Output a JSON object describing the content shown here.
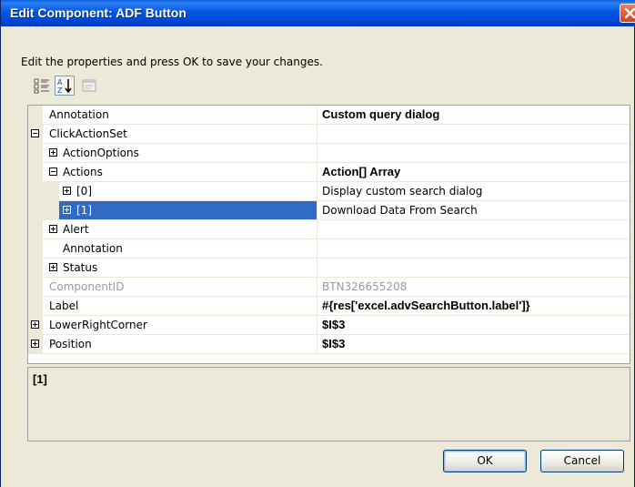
{
  "window": {
    "title": "Edit Component: ADF Button",
    "instructions": "Edit the properties and press OK to save your changes."
  },
  "toolbar": {
    "buttons": [
      {
        "icon": "categorized-icon"
      },
      {
        "icon": "alphabetical-sort-icon"
      },
      {
        "icon": "property-pages-icon"
      }
    ]
  },
  "properties": [
    {
      "name": "Annotation",
      "value": "Custom query dialog"
    },
    {
      "name": "ClickActionSet",
      "value": ""
    },
    {
      "name": "ActionOptions",
      "value": ""
    },
    {
      "name": "Actions",
      "value": "Action[] Array"
    },
    {
      "name": "[0]",
      "value": "Display custom search dialog"
    },
    {
      "name": "[1]",
      "value": "Download Data From Search"
    },
    {
      "name": "Alert",
      "value": ""
    },
    {
      "name": "Annotation",
      "value": ""
    },
    {
      "name": "Status",
      "value": ""
    },
    {
      "name": "ComponentID",
      "value": "BTN326655208"
    },
    {
      "name": "Label",
      "value": "#{res['excel.advSearchButton.label']}"
    },
    {
      "name": "LowerRightCorner",
      "value": "$I$3"
    },
    {
      "name": "Position",
      "value": "$I$3"
    }
  ],
  "description": {
    "title": "[1]"
  },
  "buttons": {
    "ok": "OK",
    "cancel": "Cancel"
  }
}
